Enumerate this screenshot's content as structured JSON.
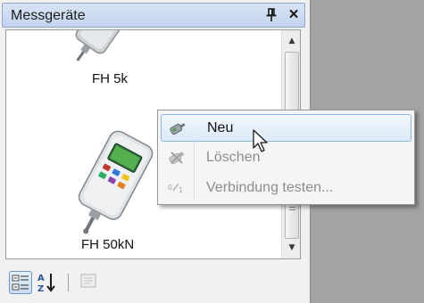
{
  "panel": {
    "title": "Messgeräte",
    "pin_icon": "pin-icon",
    "close_label": "×"
  },
  "devices": [
    {
      "label": "FH 5k",
      "icon": "force-gauge-image"
    },
    {
      "label": "FH 50kN",
      "icon": "force-gauge-image"
    }
  ],
  "scrollbar": {
    "up_glyph": "▲",
    "down_glyph": "▼"
  },
  "toolbar": {
    "categorized_icon": "categorized-view-icon",
    "alphabetical_icon": "sort-alphabetical-icon",
    "pages_icon": "property-pages-icon"
  },
  "context_menu": {
    "items": [
      {
        "label": "Neu",
        "enabled": true,
        "icon": "new-device-icon"
      },
      {
        "label": "Löschen",
        "enabled": false,
        "icon": "delete-icon"
      },
      {
        "label": "Verbindung testen...",
        "enabled": false,
        "icon": "test-connection-icon"
      }
    ]
  },
  "colors": {
    "titlebar": "#c8d9ef",
    "menu_highlight_border": "#8bb6ea",
    "disabled_text": "#8d8d8d",
    "background": "#a3a3a3"
  }
}
